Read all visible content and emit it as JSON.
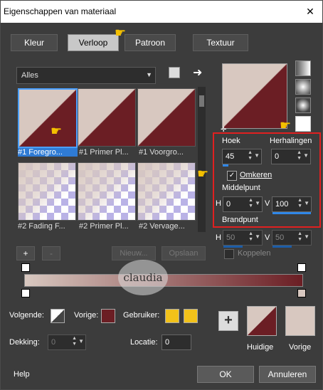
{
  "window": {
    "title": "Eigenschappen van materiaal",
    "close_glyph": "✕"
  },
  "tabs": [
    {
      "label": "Kleur"
    },
    {
      "label": "Verloop"
    },
    {
      "label": "Patroon"
    },
    {
      "label": "Textuur"
    }
  ],
  "gradient_select": {
    "value": "Alles"
  },
  "thumbnails": [
    {
      "label": "#1 Foregro..."
    },
    {
      "label": "#1 Primer Pl..."
    },
    {
      "label": "#1 Voorgro..."
    },
    {
      "label": "#2 Fading F..."
    },
    {
      "label": "#2 Primer Pl..."
    },
    {
      "label": "#2 Vervage..."
    }
  ],
  "settings": {
    "hoek_label": "Hoek",
    "hoek_value": "45",
    "herhalingen_label": "Herhalingen",
    "herhalingen_value": "0",
    "omkeren_label": "Omkeren",
    "omkeren_check": "✓",
    "middelpunt_label": "Middelpunt",
    "h_label": "H",
    "h_value": "0",
    "v_label": "V",
    "v_value": "100",
    "brandpunt_label": "Brandpunt",
    "bh_label": "H",
    "bh_value": "50",
    "bv_label": "V",
    "bv_value": "50",
    "koppelen_label": "Koppelen"
  },
  "editor": {
    "plus": "+",
    "minus": "-",
    "nieuw_label": "Nieuw...",
    "opslaan_label": "Opslaan"
  },
  "watermark": {
    "text": "claudia"
  },
  "bottom": {
    "volgende_label": "Volgende:",
    "vorige_label": "Vorige:",
    "gebruiker_label": "Gebruiker:",
    "dekking_label": "Dekking:",
    "dekking_value": "0",
    "locatie_label": "Locatie:",
    "locatie_value": "0",
    "huidige_label": "Huidige",
    "vorige2_label": "Vorige",
    "add_plus": "+"
  },
  "footer": {
    "help_label": "Help",
    "ok_label": "OK",
    "cancel_label": "Annuleren"
  },
  "colors": {
    "foreground": "#d8c8c0",
    "background": "#6b1e24",
    "user": "#f2c21a",
    "accent": "#2f87e8",
    "highlight": "#e02020"
  }
}
